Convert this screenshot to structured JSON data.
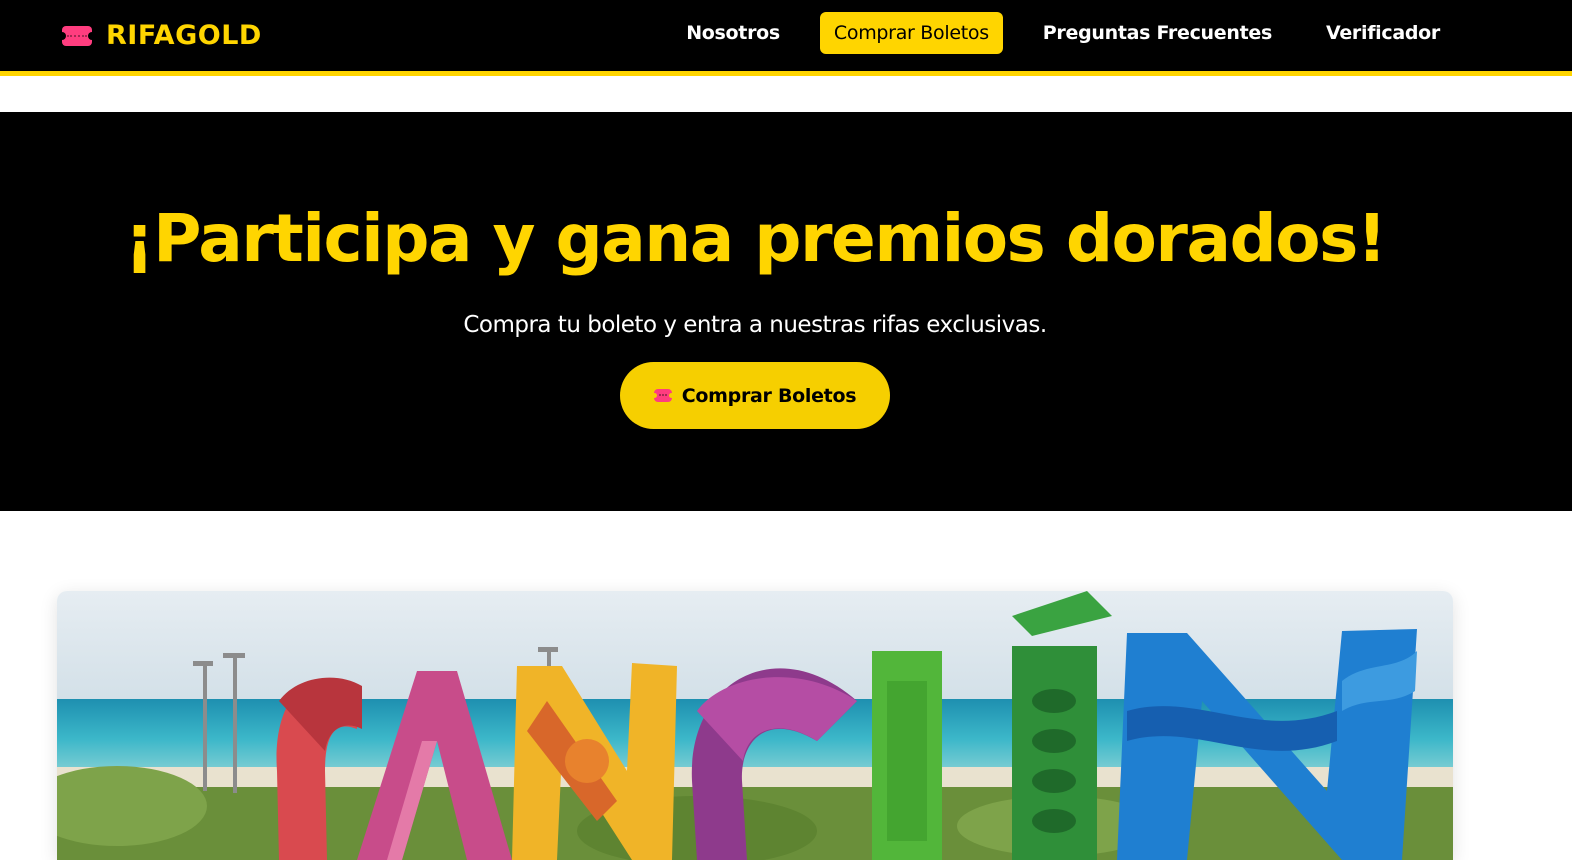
{
  "colors": {
    "accent": "#ffd500",
    "button_yellow": "#f6cf00",
    "ticket_pink": "#ff3d7f",
    "background_dark": "#000000"
  },
  "navbar": {
    "brand_icon": "ticket-icon",
    "brand_name": "RIFAGOLD",
    "links": [
      {
        "label": "Nosotros",
        "active": false
      },
      {
        "label": "Comprar Boletos",
        "active": true
      },
      {
        "label": "Preguntas Frecuentes",
        "active": false
      },
      {
        "label": "Verificador",
        "active": false
      }
    ]
  },
  "hero": {
    "title": "¡Participa y gana premios dorados!",
    "subtitle": "Compra tu boleto y entra a nuestras rifas exclusivas.",
    "cta_icon": "ticket-icon",
    "cta_label": "Comprar Boletos"
  },
  "prize": {
    "sign_text": "CANCÚN"
  }
}
